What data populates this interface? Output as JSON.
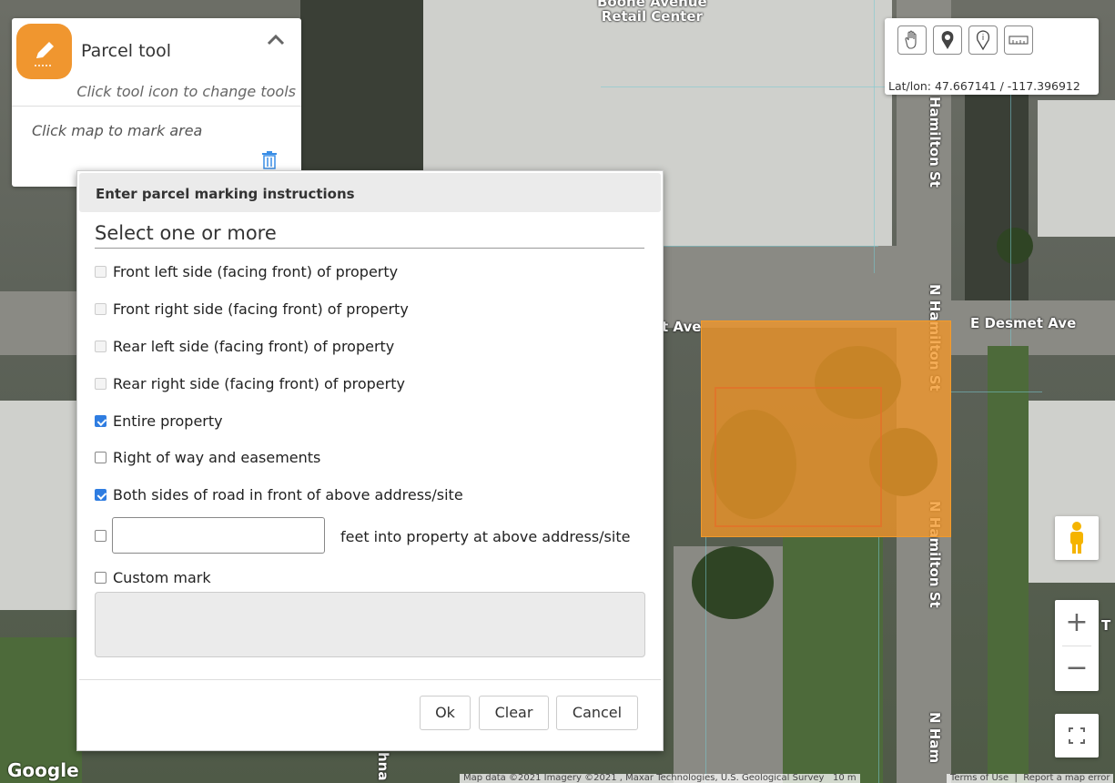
{
  "map": {
    "building_label": "Boone Avenue\nRetail Center",
    "streets": {
      "hamilton_top": "Hamilton St",
      "hamilton_mid": "N Hamilton St",
      "hamilton_lower": "N Hamilton St",
      "hamilton_bottom": "N Ham",
      "desmet_right": "E Desmet Ave",
      "desmet_left": "t Ave",
      "partial_left": "hna",
      "partial_right": "T"
    },
    "google_logo": "Google",
    "attribution": "Map data ©2021 Imagery ©2021 , Maxar Technologies, U.S. Geological Survey",
    "scale": "10 m",
    "terms": "Terms of Use",
    "report": "Report a map error"
  },
  "tool_panel": {
    "title": "Parcel tool",
    "subtitle": "Click tool icon to change tools",
    "instruction": "Click map to mark area",
    "icons": [
      "pencil-icon",
      "chevron-up-icon",
      "trash-icon"
    ],
    "accent": "#f0962f"
  },
  "coord_panel": {
    "tools": [
      "hand-icon",
      "map-pin-icon",
      "info-pin-icon",
      "ruler-icon"
    ],
    "coords_label": "Lat/lon:",
    "lat": "47.667141",
    "sep": "/",
    "lon": "-117.396912"
  },
  "dialog": {
    "header": "Enter parcel marking instructions",
    "section": "Select one or more",
    "options": [
      {
        "label": "Front left side (facing front) of property",
        "checked": false,
        "disabled": true
      },
      {
        "label": "Front right side (facing front) of property",
        "checked": false,
        "disabled": true
      },
      {
        "label": "Rear left side (facing front) of property",
        "checked": false,
        "disabled": true
      },
      {
        "label": "Rear right side (facing front) of property",
        "checked": false,
        "disabled": true
      },
      {
        "label": "Entire property",
        "checked": true,
        "disabled": false
      },
      {
        "label": "Right of way and easements",
        "checked": false,
        "disabled": false
      },
      {
        "label": "Both sides of road in front of above address/site",
        "checked": true,
        "disabled": false
      }
    ],
    "feet": {
      "value": "",
      "suffix": "feet into property at above address/site",
      "checked": false
    },
    "custom": {
      "label": "Custom mark",
      "checked": false,
      "value": ""
    },
    "buttons": {
      "ok": "Ok",
      "clear": "Clear",
      "cancel": "Cancel"
    }
  },
  "controls": {
    "zoom_in": "+",
    "zoom_out": "−",
    "icons": [
      "pegman-icon",
      "zoom-in-icon",
      "zoom-out-icon",
      "fullscreen-icon"
    ]
  }
}
